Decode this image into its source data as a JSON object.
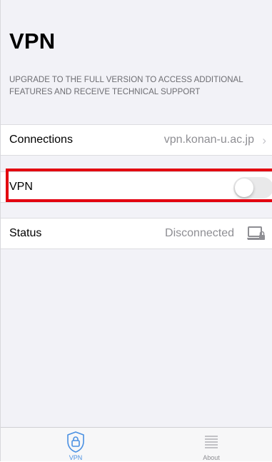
{
  "header": {
    "title": "VPN",
    "promo": "UPGRADE TO THE FULL VERSION TO ACCESS ADDITIONAL FEATURES AND RECEIVE TECHNICAL SUPPORT"
  },
  "rows": {
    "connections": {
      "label": "Connections",
      "value": "vpn.konan-u.ac.jp",
      "chevron": "›"
    },
    "vpn": {
      "label": "VPN",
      "toggle_on": false
    },
    "status": {
      "label": "Status",
      "value": "Disconnected",
      "icon": "computer-lock-icon"
    }
  },
  "tabs": [
    {
      "label": "VPN",
      "icon": "shield-lock-icon",
      "selected": true
    },
    {
      "label": "About",
      "icon": "list-icon",
      "selected": false
    }
  ],
  "colors": {
    "background": "#f2f2f7",
    "highlight": "#e3000f",
    "tab_active": "#4a90e2",
    "secondary_text": "#8e8e93"
  }
}
